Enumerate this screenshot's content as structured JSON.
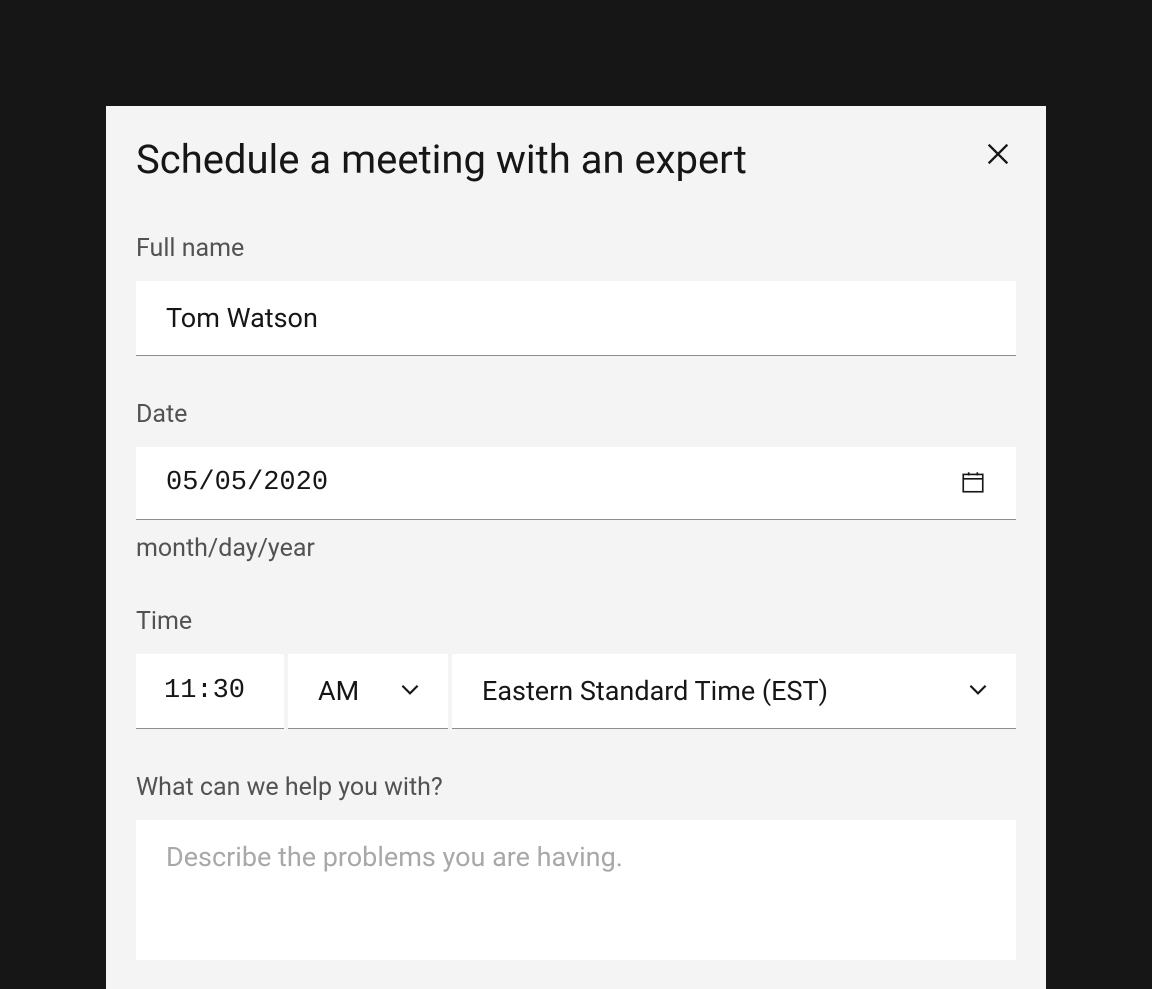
{
  "modal": {
    "title": "Schedule a meeting with an expert",
    "fields": {
      "fullname": {
        "label": "Full name",
        "value": "Tom Watson"
      },
      "date": {
        "label": "Date",
        "value": "05/05/2020",
        "helper": "month/day/year"
      },
      "time": {
        "label": "Time",
        "value": "11:30",
        "ampm": "AM",
        "timezone": "Eastern Standard Time (EST)"
      },
      "help": {
        "label": "What can we help you with?",
        "placeholder": "Describe the problems you are having."
      }
    }
  }
}
